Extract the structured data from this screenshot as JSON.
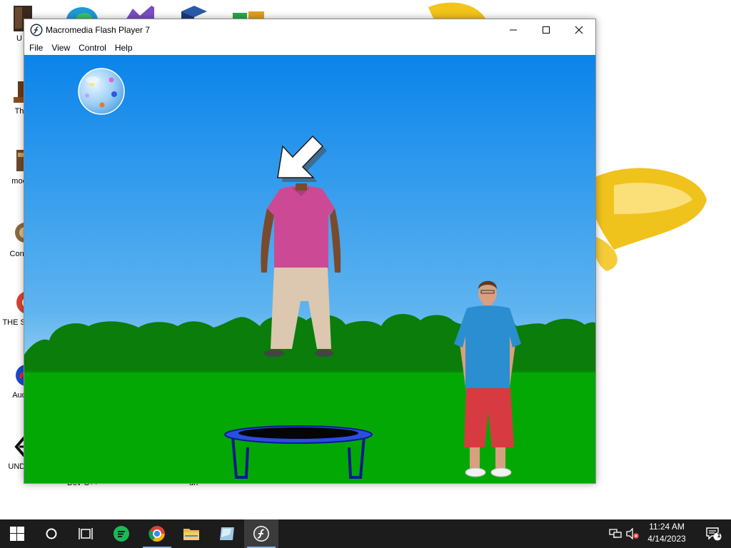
{
  "window": {
    "title": "Macromedia Flash Player 7",
    "menu": [
      "File",
      "View",
      "Control",
      "Help"
    ]
  },
  "desktop": {
    "icon_labels": [
      "U",
      "Th",
      "mod",
      "Contr",
      "THE SPV",
      "Aud",
      "UNDE",
      "Dev-C++",
      "un"
    ]
  },
  "taskbar": {
    "time": "11:24 AM",
    "date": "4/14/2023",
    "notification_count": "1"
  },
  "colors": {
    "sky_top": "#0a84ea",
    "sky_bottom": "#b3dcf5",
    "bush": "#0a7d0a",
    "grass": "#04a804",
    "trampoline": "#0a1a8c"
  }
}
